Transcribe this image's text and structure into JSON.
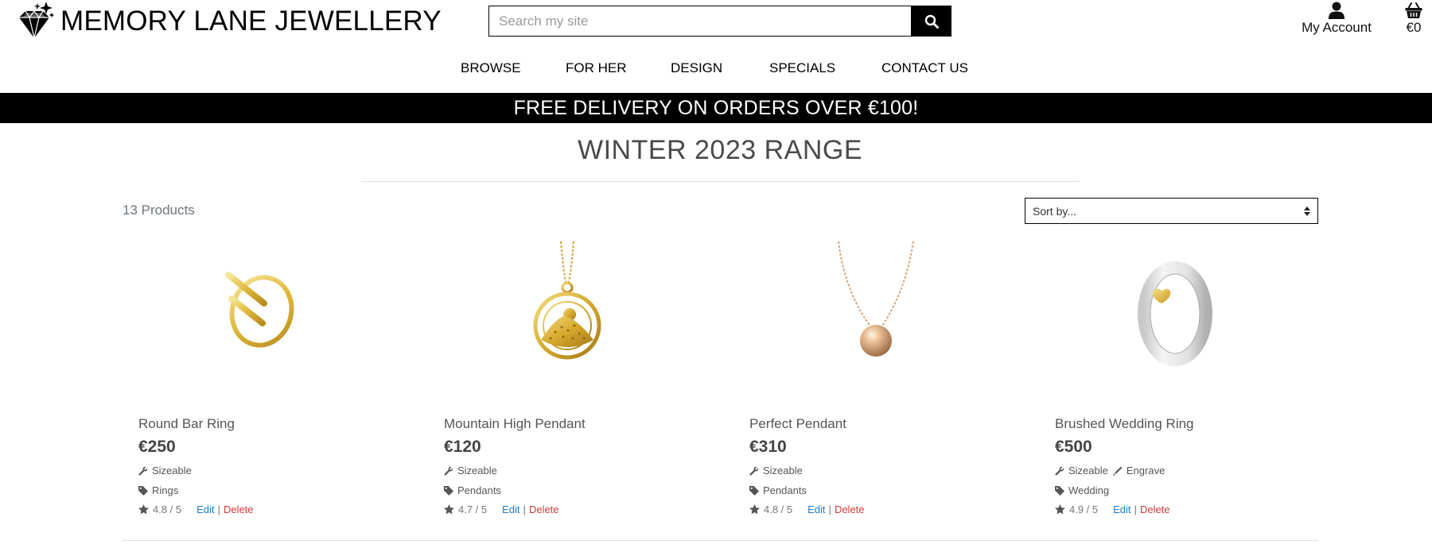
{
  "header": {
    "brand": "MEMORY LANE JEWELLERY",
    "search_placeholder": "Search my site",
    "account_label": "My Account",
    "bag_total": "€0"
  },
  "nav": {
    "items": [
      {
        "label": "BROWSE"
      },
      {
        "label": "FOR HER"
      },
      {
        "label": "DESIGN"
      },
      {
        "label": "SPECIALS"
      },
      {
        "label": "CONTACT US"
      }
    ]
  },
  "banner": {
    "text": "FREE DELIVERY ON ORDERS OVER €100!"
  },
  "page": {
    "title": "WINTER 2023 RANGE",
    "product_count": "13 Products",
    "sort_label": "Sort by..."
  },
  "products": [
    {
      "name": "Round Bar Ring",
      "price": "€250",
      "feature": "Sizeable",
      "feature2": "",
      "category": "Rings",
      "rating": "4.8 / 5",
      "edit": "Edit",
      "delete": "Delete",
      "image": "gold-ring-image"
    },
    {
      "name": "Mountain High Pendant",
      "price": "€120",
      "feature": "Sizeable",
      "feature2": "",
      "category": "Pendants",
      "rating": "4.7 / 5",
      "edit": "Edit",
      "delete": "Delete",
      "image": "mountain-pendant-image"
    },
    {
      "name": "Perfect Pendant",
      "price": "€310",
      "feature": "Sizeable",
      "feature2": "",
      "category": "Pendants",
      "rating": "4.8 / 5",
      "edit": "Edit",
      "delete": "Delete",
      "image": "ball-pendant-image"
    },
    {
      "name": "Brushed Wedding Ring",
      "price": "€500",
      "feature": "Sizeable",
      "feature2": "Engrave",
      "category": "Wedding",
      "rating": "4.9 / 5",
      "edit": "Edit",
      "delete": "Delete",
      "image": "silver-ring-image"
    }
  ],
  "colors": {
    "edit_link": "#1f7ac2",
    "delete_link": "#d33a3a",
    "banner_bg": "#000000",
    "gold": "#e3bf3a"
  }
}
